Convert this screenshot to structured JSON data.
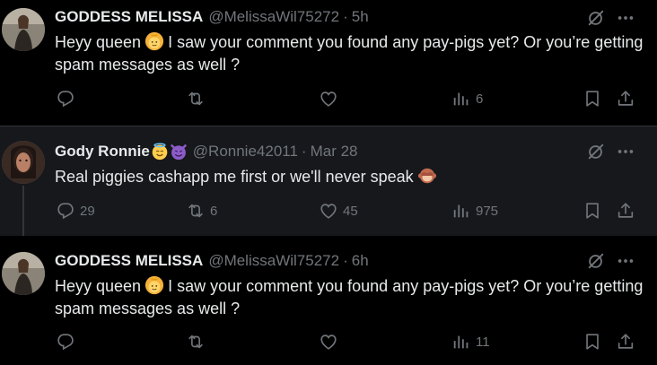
{
  "tweets": [
    {
      "name": "GODDESS MELISSA",
      "handle": "@MelissaWil75272",
      "separator": "·",
      "time": "5h",
      "text_before": "Heyy queen",
      "text_after": "I saw your comment you found any pay-pigs yet? Or you’re getting spam messages as well ?",
      "replies": "",
      "retweets": "",
      "likes": "",
      "views": "6"
    },
    {
      "name": "Gody Ronnie",
      "handle": "@Ronnie42011",
      "separator": "·",
      "time": "Mar 28",
      "text_before": "Real piggies cashapp me first or we'll never speak",
      "replies": "29",
      "retweets": "6",
      "likes": "45",
      "views": "975"
    },
    {
      "name": "GODDESS MELISSA",
      "handle": "@MelissaWil75272",
      "separator": "·",
      "time": "6h",
      "text_before": "Heyy queen",
      "text_after": "I saw your comment you found any pay-pigs yet? Or you’re getting spam messages as well ?",
      "replies": "",
      "retweets": "",
      "likes": "",
      "views": "11"
    }
  ],
  "icons": {
    "reply": "reply-icon",
    "retweet": "retweet-icon",
    "like": "heart-icon",
    "views": "views-icon",
    "bookmark": "bookmark-icon",
    "share": "share-icon",
    "grok": "grok-icon",
    "more": "more-icon"
  },
  "colors": {
    "background": "#000000",
    "highlight_background": "#16181c",
    "text": "#e7e9ea",
    "secondary": "#71767b",
    "divider": "#2f3336"
  }
}
